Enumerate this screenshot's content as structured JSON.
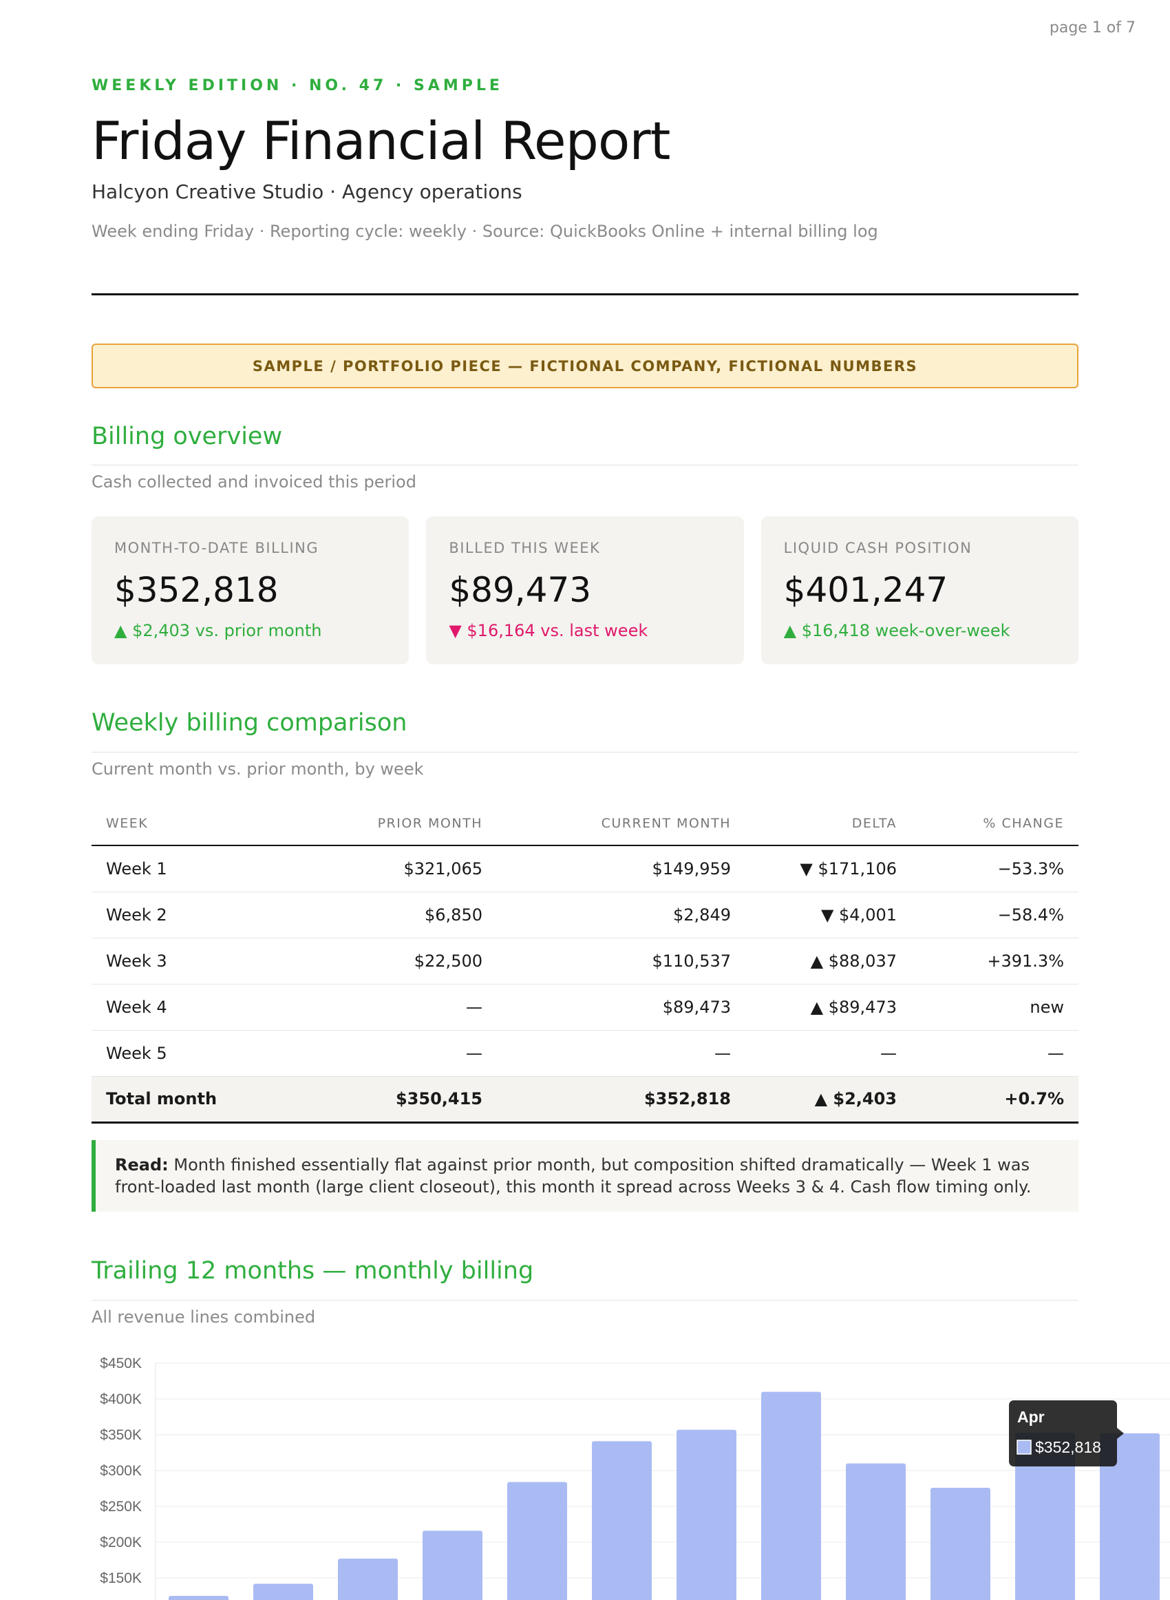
{
  "page_indicator": "page 1 of 7",
  "header": {
    "eyebrow": "WEEKLY EDITION · NO. 47 · SAMPLE",
    "title": "Friday Financial Report",
    "subtitle": "Halcyon Creative Studio · Agency operations",
    "meta": "Week ending Friday · Reporting cycle: weekly · Source: QuickBooks Online + internal billing log"
  },
  "banner": "SAMPLE / PORTFOLIO PIECE — FICTIONAL COMPANY, FICTIONAL NUMBERS",
  "billing_overview": {
    "heading": "Billing overview",
    "sub": "Cash collected and invoiced this period",
    "cards": [
      {
        "label": "MONTH-TO-DATE BILLING",
        "value": "$352,818",
        "delta": "▲ $2,403 vs. prior month",
        "direction": "up"
      },
      {
        "label": "BILLED THIS WEEK",
        "value": "$89,473",
        "delta": "▼ $16,164 vs. last week",
        "direction": "down"
      },
      {
        "label": "LIQUID CASH POSITION",
        "value": "$401,247",
        "delta": "▲ $16,418 week-over-week",
        "direction": "up"
      }
    ]
  },
  "weekly": {
    "heading": "Weekly billing comparison",
    "sub": "Current month vs. prior month, by week",
    "columns": [
      "WEEK",
      "PRIOR MONTH",
      "CURRENT MONTH",
      "DELTA",
      "% CHANGE"
    ],
    "rows": [
      {
        "week": "Week 1",
        "prior": "$321,065",
        "current": "$149,959",
        "delta": "▼ $171,106",
        "pct": "−53.3%",
        "dir": "down"
      },
      {
        "week": "Week 2",
        "prior": "$6,850",
        "current": "$2,849",
        "delta": "▼ $4,001",
        "pct": "−58.4%",
        "dir": "down"
      },
      {
        "week": "Week 3",
        "prior": "$22,500",
        "current": "$110,537",
        "delta": "▲ $88,037",
        "pct": "+391.3%",
        "dir": "up"
      },
      {
        "week": "Week 4",
        "prior": "—",
        "current": "$89,473",
        "delta": "▲ $89,473",
        "pct": "new",
        "dir": "up"
      },
      {
        "week": "Week 5",
        "prior": "—",
        "current": "—",
        "delta": "—",
        "pct": "—",
        "dir": "none"
      }
    ],
    "total": {
      "week": "Total month",
      "prior": "$350,415",
      "current": "$352,818",
      "delta": "▲ $2,403",
      "pct": "+0.7%"
    }
  },
  "callout": {
    "lead": "Read:",
    "text": " Month finished essentially flat against prior month, but composition shifted dramatically — Week 1 was front-loaded last month (large client closeout), this month it spread across Weeks 3 & 4. Cash flow timing only."
  },
  "trailing": {
    "heading": "Trailing 12 months — monthly billing",
    "sub": "All revenue lines combined"
  },
  "chart_data": {
    "type": "bar",
    "y_tick_labels": [
      "$450K",
      "$400K",
      "$350K",
      "$300K",
      "$250K",
      "$200K",
      "$150K"
    ],
    "ylim": [
      0,
      450000
    ],
    "values": [
      125000,
      142000,
      177000,
      216000,
      284000,
      341000,
      357000,
      410000,
      310000,
      276000,
      352818,
      352000
    ],
    "bar_color": "#aabbf4",
    "grid": true,
    "tooltip": {
      "label": "Apr",
      "value": "$352,818"
    }
  },
  "colors": {
    "accent": "#2fae3e",
    "negative": "#e0196b",
    "bar": "#aabbf4"
  }
}
